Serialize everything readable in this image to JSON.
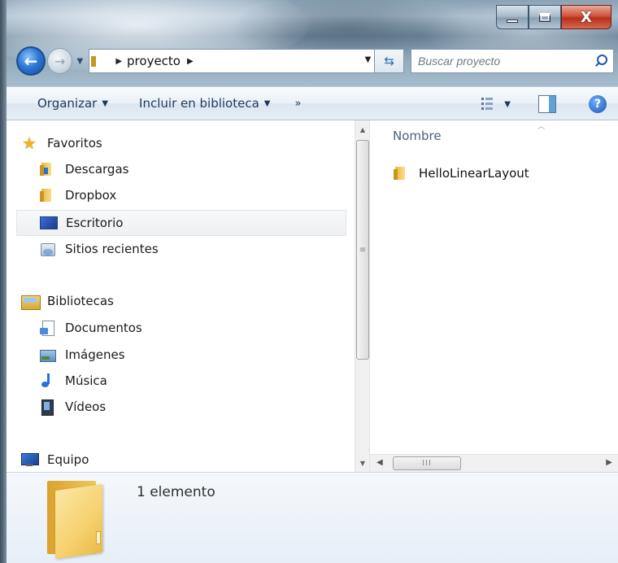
{
  "window": {
    "controls": {
      "minimize_icon": "minimize-icon",
      "maximize_icon": "maximize-icon",
      "close_glyph": "X"
    }
  },
  "nav": {
    "back_glyph": "←",
    "forward_glyph": "→",
    "address": {
      "crumbs": [
        "proyecto"
      ]
    },
    "search": {
      "placeholder": "Buscar proyecto"
    }
  },
  "toolbar": {
    "organize_label": "Organizar",
    "include_label": "Incluir en biblioteca",
    "more_label": "»"
  },
  "sidebar": {
    "favorites_header": "Favoritos",
    "favorites": [
      {
        "label": "Descargas",
        "icon": "downloads-folder-icon"
      },
      {
        "label": "Dropbox",
        "icon": "folder-icon"
      },
      {
        "label": "Escritorio",
        "icon": "desktop-icon",
        "selected": true
      },
      {
        "label": "Sitios recientes",
        "icon": "recent-places-icon"
      }
    ],
    "libraries_header": "Bibliotecas",
    "libraries": [
      {
        "label": "Documentos",
        "icon": "documents-icon"
      },
      {
        "label": "Imágenes",
        "icon": "pictures-icon"
      },
      {
        "label": "Música",
        "icon": "music-icon"
      },
      {
        "label": "Vídeos",
        "icon": "videos-icon"
      }
    ],
    "computer_header": "Equipo"
  },
  "content": {
    "column_header": "Nombre",
    "items": [
      {
        "name": "HelloLinearLayout",
        "icon": "folder-icon"
      }
    ]
  },
  "details": {
    "item_count": "1 elemento"
  },
  "colors": {
    "command_bar_text": "#1e395b",
    "selection_bg": "#eef0f2",
    "close_button": "#c84330",
    "folder_yellow": "#f6d16e"
  }
}
